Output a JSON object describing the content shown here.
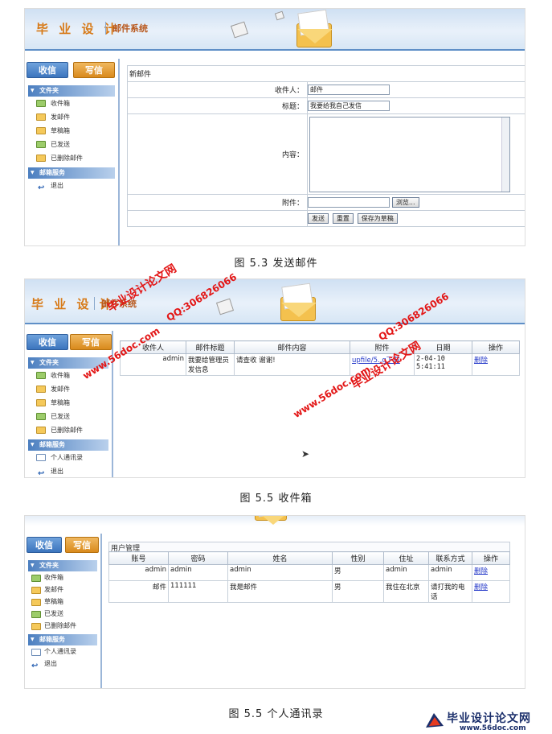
{
  "header": {
    "logo": "毕 业 设 计",
    "system": "邮件系统"
  },
  "sidebar": {
    "inbox_btn": "收信",
    "write_btn": "写信",
    "section_folders": "文件夹",
    "section_services": "邮箱服务",
    "folders": [
      "收件箱",
      "发邮件",
      "草稿箱",
      "已发送",
      "已删除邮件"
    ],
    "contacts": "个人通讯录",
    "logout": "退出"
  },
  "fig1": {
    "title": "新邮件",
    "recipient_label": "收件人：",
    "recipient_value": "邮件",
    "subject_label": "标题：",
    "subject_value": "我要给我自己发信",
    "content_label": "内容：",
    "attach_label": "附件：",
    "browse": "浏览...",
    "send": "发送",
    "reset": "重置",
    "draft": "保存为草稿",
    "caption": "图 5.3  发送邮件"
  },
  "fig2": {
    "columns": [
      "收件人",
      "邮件标题",
      "邮件内容",
      "附件",
      "日期",
      "操作"
    ],
    "row": {
      "sender": "admin",
      "subject": "我要给管理员发信息",
      "content": "请查收 谢谢!",
      "attachment": "upfile/5..g下载",
      "date": "2-04-10 5:41:11",
      "action": "删除"
    },
    "caption": "图 5.5  收件箱"
  },
  "fig3": {
    "title": "用户管理",
    "columns": [
      "账号",
      "密码",
      "姓名",
      "性别",
      "住址",
      "联系方式",
      "操作"
    ],
    "rows": [
      [
        "admin",
        "admin",
        "admin",
        "男",
        "admin",
        "admin",
        "删除"
      ],
      [
        "邮件",
        "111111",
        "我是邮件",
        "男",
        "我住在北京",
        "请打我的电话",
        "删除"
      ]
    ],
    "caption": "图 5.5  个人通讯录"
  },
  "watermark": {
    "site": "www.56doc.com",
    "name": "毕业设计论文网",
    "qq": "QQ:306826066"
  },
  "footer": {
    "name": "毕业设计论文网",
    "site": "www.56doc.com"
  }
}
